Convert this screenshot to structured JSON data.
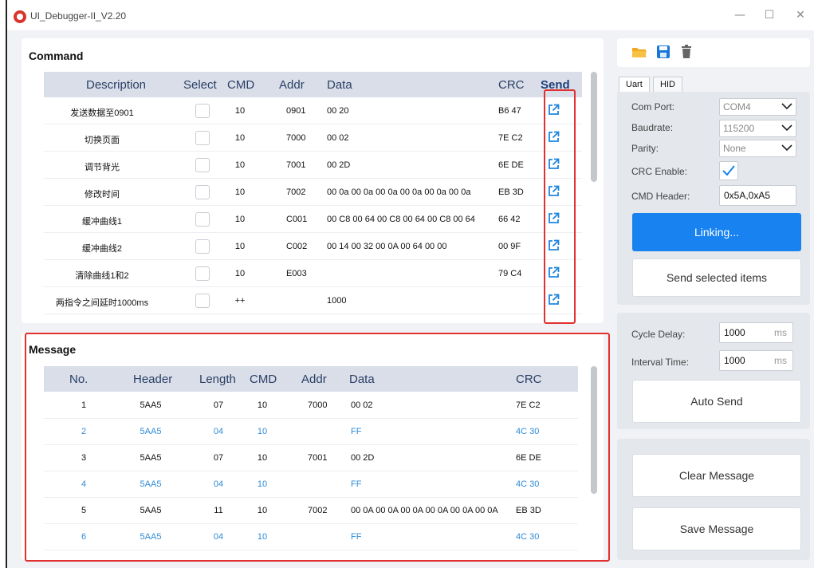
{
  "window": {
    "title": "UI_Debugger-II_V2.20",
    "controls": {
      "minimize": "—",
      "maximize": "☐",
      "close": "✕"
    }
  },
  "command": {
    "title": "Command",
    "columns": [
      "Description",
      "Select",
      "CMD",
      "Addr",
      "Data",
      "CRC",
      "Send"
    ],
    "rows": [
      {
        "description": "发送数据至0901",
        "cmd": "10",
        "addr": "0901",
        "data": "00 20",
        "crc": "B6 47"
      },
      {
        "description": "切换页面",
        "cmd": "10",
        "addr": "7000",
        "data": "00 02",
        "crc": "7E C2"
      },
      {
        "description": "调节背光",
        "cmd": "10",
        "addr": "7001",
        "data": "00 2D",
        "crc": "6E DE"
      },
      {
        "description": "修改时间",
        "cmd": "10",
        "addr": "7002",
        "data": "00 0a 00 0a 00 0a 00 0a 00 0a 00 0a",
        "crc": "EB 3D"
      },
      {
        "description": "缓冲曲线1",
        "cmd": "10",
        "addr": "C001",
        "data": "00 C8 00 64 00 C8 00 64 00 C8 00 64",
        "crc": "66 42"
      },
      {
        "description": "缓冲曲线2",
        "cmd": "10",
        "addr": "C002",
        "data": "00 14 00 32 00 0A 00 64 00 00",
        "crc": "00 9F"
      },
      {
        "description": "清除曲线1和2",
        "cmd": "10",
        "addr": "E003",
        "data": "",
        "crc": "79 C4"
      },
      {
        "description": "两指令之间延时1000ms",
        "cmd": "++",
        "addr": "",
        "data": "1000",
        "crc": ""
      }
    ],
    "icons": {
      "send": "external-link-icon"
    }
  },
  "message": {
    "title": "Message",
    "columns": [
      "No.",
      "Header",
      "Length",
      "CMD",
      "Addr",
      "Data",
      "CRC"
    ],
    "rows": [
      {
        "no": "1",
        "header": "5AA5",
        "length": "07",
        "cmd": "10",
        "addr": "7000",
        "data": "00 02",
        "crc": "7E C2",
        "type": "sent"
      },
      {
        "no": "2",
        "header": "5AA5",
        "length": "04",
        "cmd": "10",
        "addr": "",
        "data": "FF",
        "crc": "4C 30",
        "type": "received"
      },
      {
        "no": "3",
        "header": "5AA5",
        "length": "07",
        "cmd": "10",
        "addr": "7001",
        "data": "00 2D",
        "crc": "6E DE",
        "type": "sent"
      },
      {
        "no": "4",
        "header": "5AA5",
        "length": "04",
        "cmd": "10",
        "addr": "",
        "data": "FF",
        "crc": "4C 30",
        "type": "received"
      },
      {
        "no": "5",
        "header": "5AA5",
        "length": "11",
        "cmd": "10",
        "addr": "7002",
        "data": "00 0A 00 0A 00 0A 00 0A 00 0A 00 0A",
        "crc": "EB 3D",
        "type": "sent"
      },
      {
        "no": "6",
        "header": "5AA5",
        "length": "04",
        "cmd": "10",
        "addr": "",
        "data": "FF",
        "crc": "4C 30",
        "type": "received"
      }
    ]
  },
  "toolbar": {
    "icons": [
      "folder-open-icon",
      "save-icon",
      "trash-icon"
    ]
  },
  "settings": {
    "tabs": [
      "Uart",
      "HID"
    ],
    "active_tab": "Uart",
    "com_port_label": "Com Port:",
    "com_port_value": "COM4",
    "baudrate_label": "Baudrate:",
    "baudrate_value": "115200",
    "parity_label": "Parity:",
    "parity_value": "None",
    "crc_label": "CRC Enable:",
    "crc_enabled": true,
    "cmd_header_label": "CMD Header:",
    "cmd_header_value": "0x5A,0xA5",
    "linking_label": "Linking...",
    "send_selected_label": "Send selected items"
  },
  "auto": {
    "cycle_delay_label": "Cycle Delay:",
    "cycle_delay_value": "1000",
    "cycle_delay_unit": "ms",
    "interval_label": "Interval Time:",
    "interval_value": "1000",
    "interval_unit": "ms",
    "auto_send_label": "Auto Send"
  },
  "actions": {
    "clear_label": "Clear Message",
    "save_label": "Save Message"
  },
  "colors": {
    "accent": "#1883f0",
    "highlight_border": "#e0302f",
    "received_text": "#2f8bd6",
    "header_bg": "#d9dee8"
  }
}
